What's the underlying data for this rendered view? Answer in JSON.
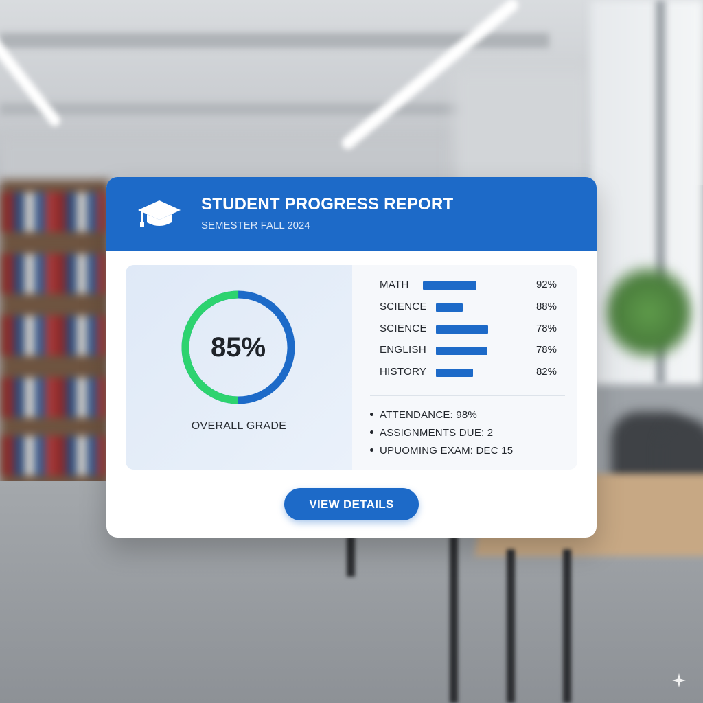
{
  "header": {
    "title": "STUDENT PROGRESS REPORT",
    "subtitle": "SEMESTER FALL 2024",
    "icon": "graduation-cap-icon"
  },
  "overall": {
    "value_text": "85%",
    "value": 85,
    "label": "OVERALL GRADE",
    "colors": {
      "progress": "#2dd36f",
      "remainder": "#1d6ac8"
    }
  },
  "subjects": [
    {
      "name": "MATH",
      "value_text": "92%"
    },
    {
      "name": "SCIENCE",
      "value_text": "88%"
    },
    {
      "name": "SCIENCE",
      "value_text": "78%"
    },
    {
      "name": "ENGLISH",
      "value_text": "78%"
    },
    {
      "name": "HISTORY",
      "value_text": "82%"
    }
  ],
  "info": [
    "ATTENDANCE: 98%",
    "ASSIGNMENTS DUE: 2",
    "UPUOMING EXAM: DEC 15"
  ],
  "actions": {
    "view_details": "VIEW DETAILS"
  },
  "theme": {
    "accent": "#1d6ac8",
    "success": "#2dd36f",
    "text": "#23272d"
  }
}
